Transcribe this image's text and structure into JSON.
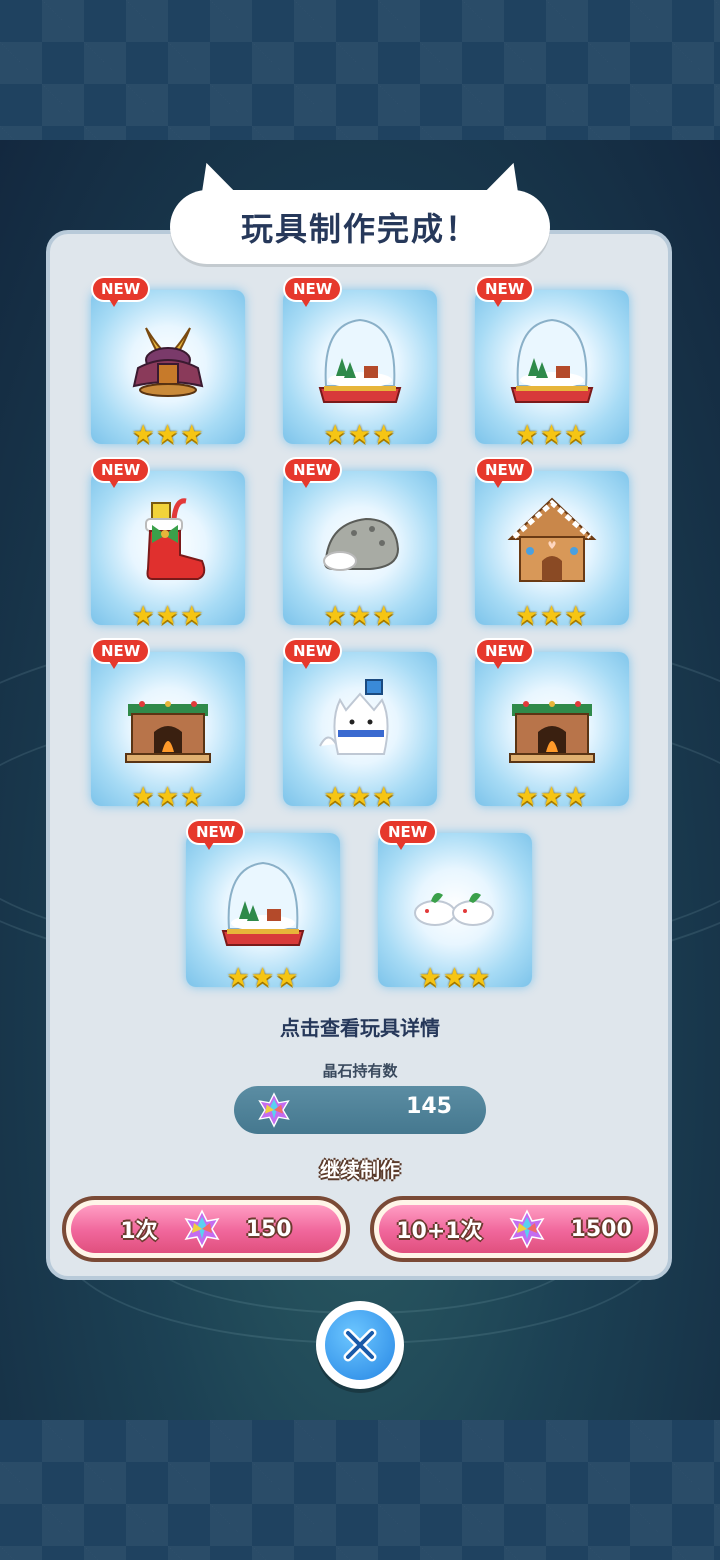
{
  "title": "玩具制作完成！",
  "new_label": "NEW",
  "stars_text": "★★★",
  "toys": [
    {
      "name": "samurai-helmet-icon",
      "rarity_stars": 3
    },
    {
      "name": "snow-globe-icon",
      "rarity_stars": 3
    },
    {
      "name": "snow-globe-icon",
      "rarity_stars": 3
    },
    {
      "name": "christmas-boot-icon",
      "rarity_stars": 3
    },
    {
      "name": "seal-plush-icon",
      "rarity_stars": 3
    },
    {
      "name": "gingerbread-house-icon",
      "rarity_stars": 3
    },
    {
      "name": "fireplace-icon",
      "rarity_stars": 3
    },
    {
      "name": "snow-cat-icon",
      "rarity_stars": 3
    },
    {
      "name": "fireplace-icon",
      "rarity_stars": 3
    },
    {
      "name": "snow-globe-icon",
      "rarity_stars": 3
    },
    {
      "name": "snow-bunny-icon",
      "rarity_stars": 3
    }
  ],
  "hint": "点击查看玩具详情",
  "crystal": {
    "label": "晶石持有数",
    "count": "145"
  },
  "continue_label": "继续制作",
  "buttons": {
    "single": {
      "label": "1次",
      "cost": "150"
    },
    "multi": {
      "label": "10+1次",
      "cost": "1500"
    }
  },
  "colors": {
    "accent_pink": "#f0669b",
    "new_badge": "#e6382c",
    "star": "#f6c514",
    "close_blue": "#2686e4"
  }
}
